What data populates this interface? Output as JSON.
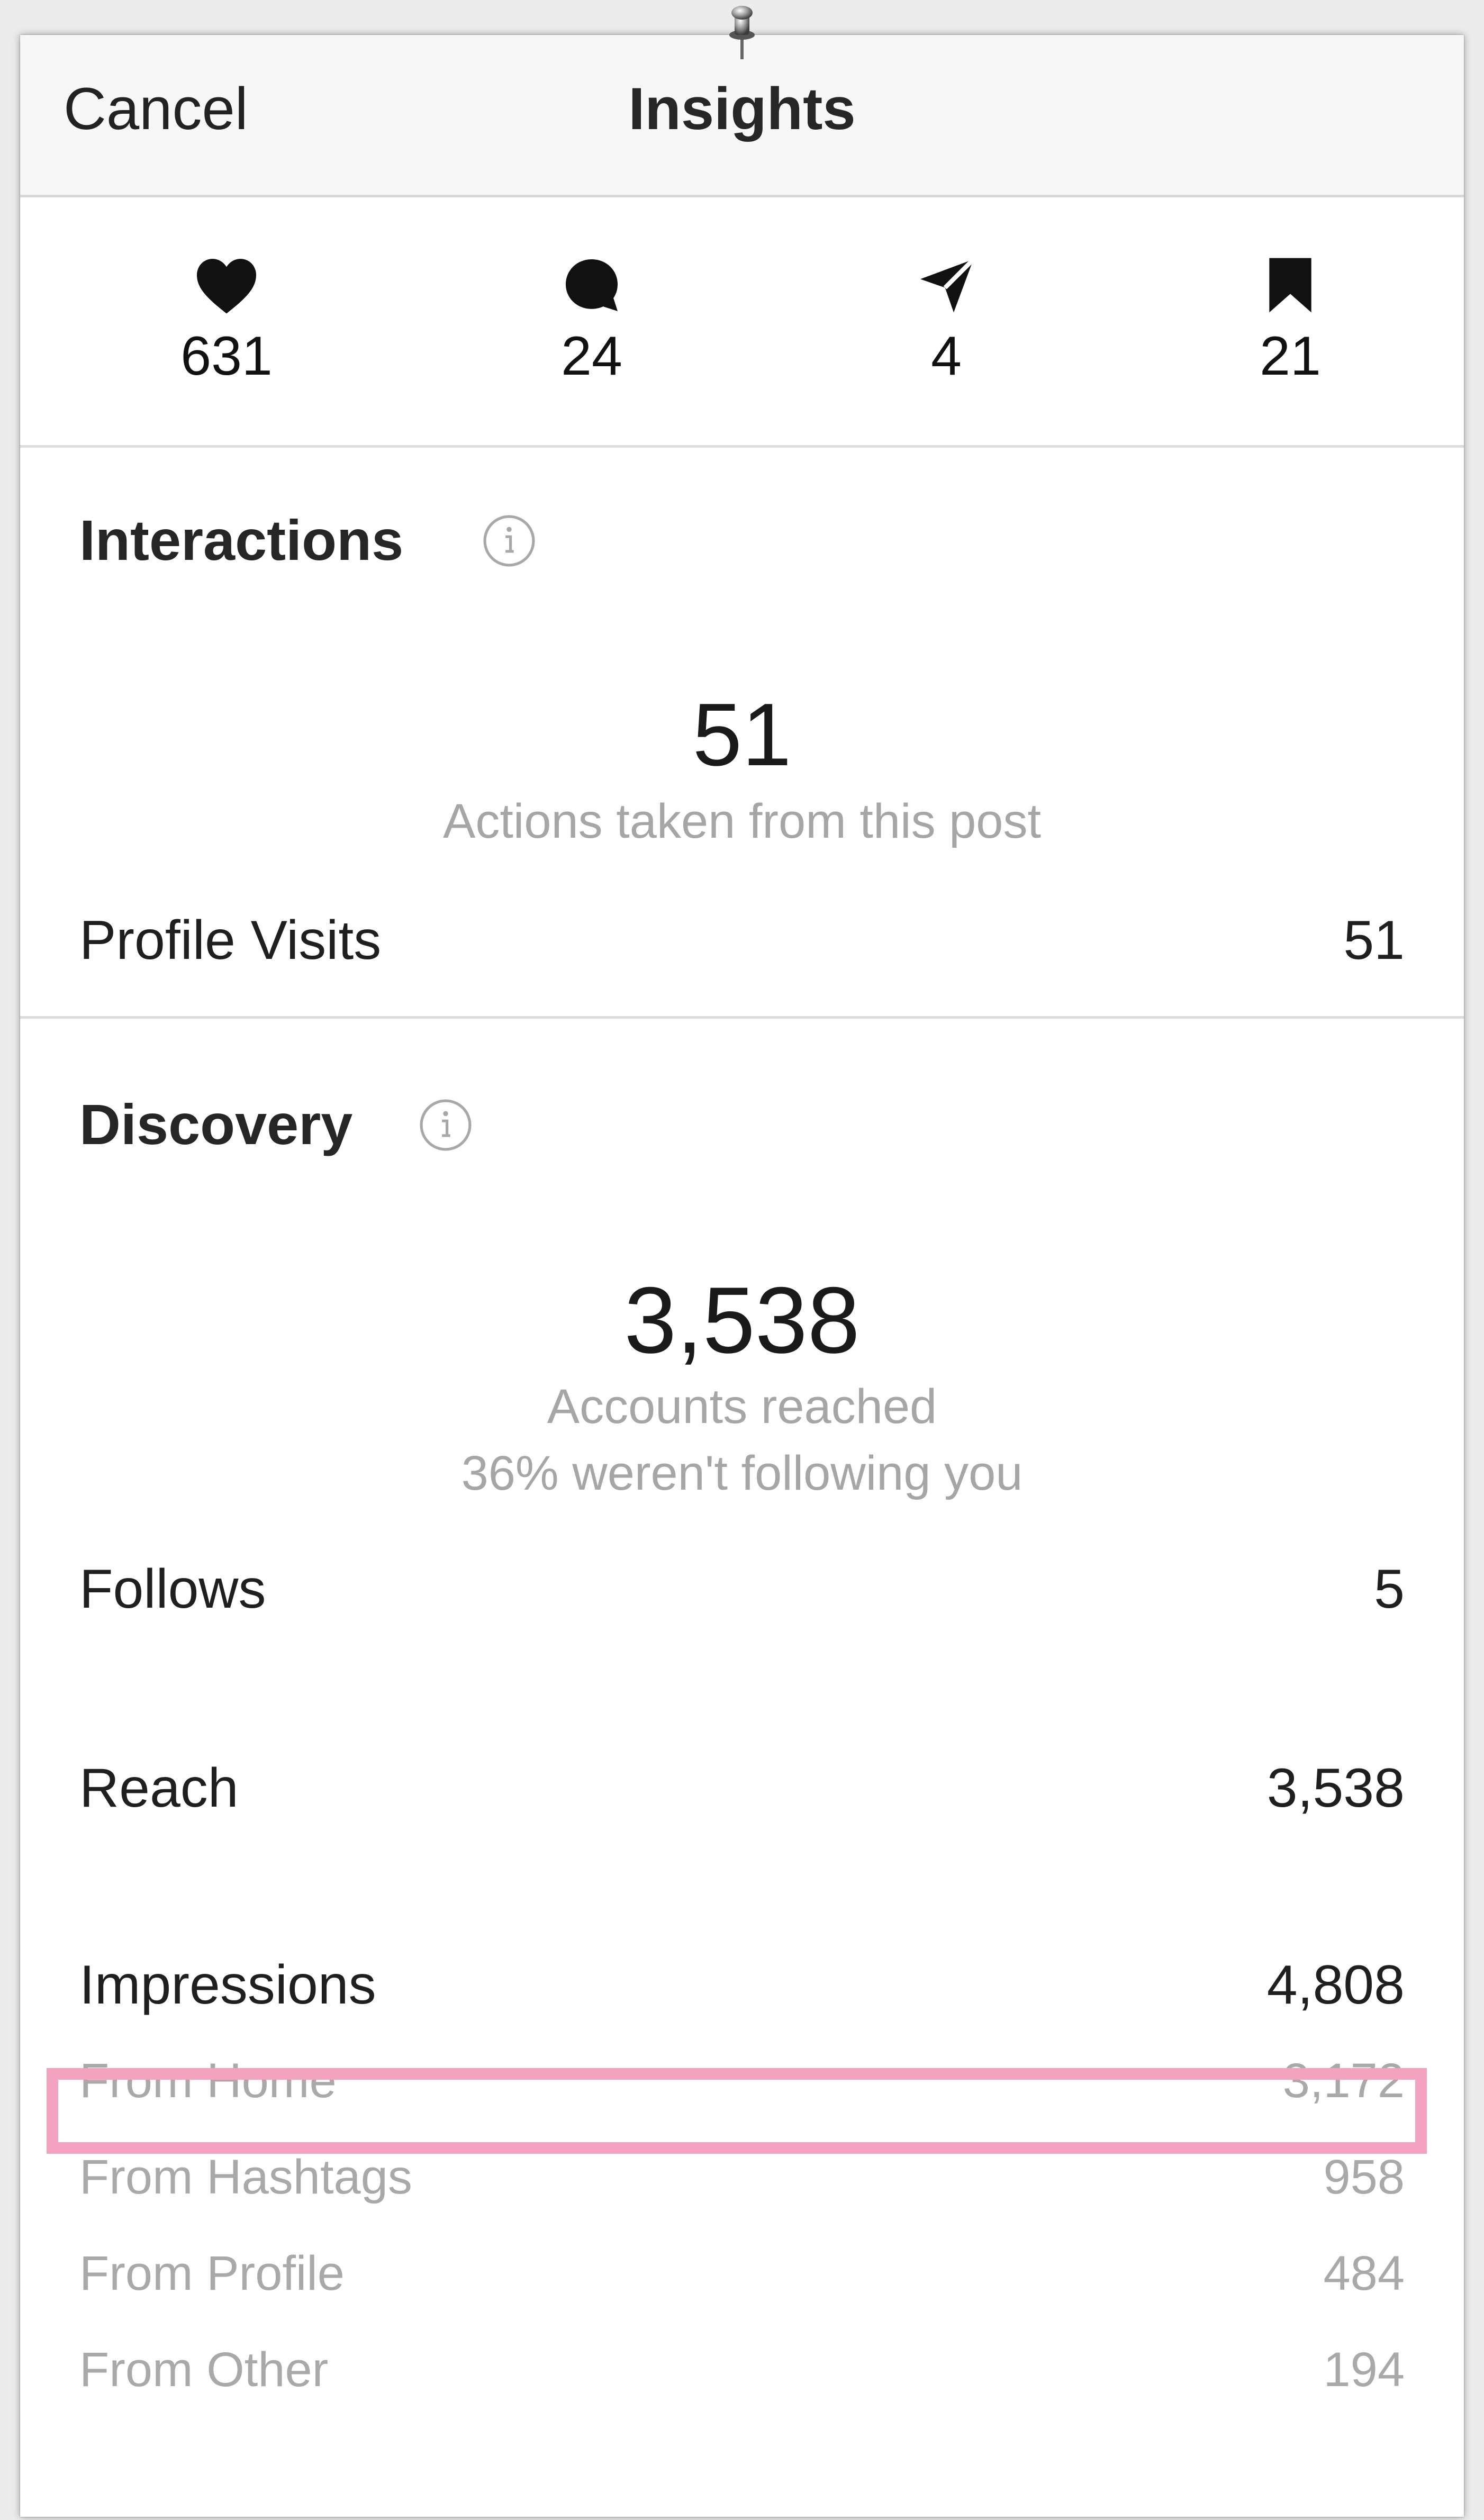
{
  "navbar": {
    "cancel_label": "Cancel",
    "title": "Insights"
  },
  "stats": [
    {
      "icon": "heart-icon",
      "value": "631"
    },
    {
      "icon": "comment-icon",
      "value": "24"
    },
    {
      "icon": "share-icon",
      "value": "4"
    },
    {
      "icon": "bookmark-icon",
      "value": "21"
    }
  ],
  "interactions": {
    "title": "Interactions",
    "total": "51",
    "caption": "Actions taken from this post",
    "rows": [
      {
        "label": "Profile Visits",
        "value": "51"
      }
    ]
  },
  "discovery": {
    "title": "Discovery",
    "total": "3,538",
    "caption": "Accounts reached",
    "caption2": "36% weren't following you",
    "rows": [
      {
        "label": "Follows",
        "value": "5"
      },
      {
        "label": "Reach",
        "value": "3,538"
      },
      {
        "label": "Impressions",
        "value": "4,808"
      }
    ],
    "impression_sources": [
      {
        "label": "From Home",
        "value": "3,172"
      },
      {
        "label": "From Hashtags",
        "value": "958"
      },
      {
        "label": "From Profile",
        "value": "484"
      },
      {
        "label": "From Other",
        "value": "194"
      }
    ]
  },
  "colors": {
    "highlight": "#f3a2bf",
    "muted_text": "#a9a9a9",
    "primary_text": "#1f1f1f"
  }
}
